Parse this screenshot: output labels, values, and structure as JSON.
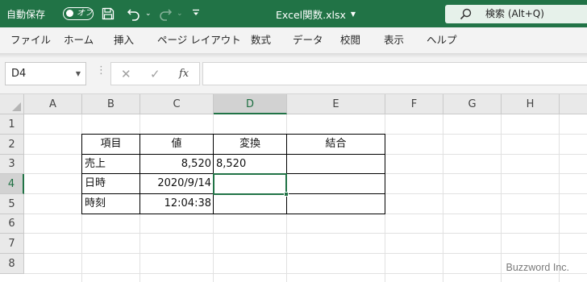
{
  "titlebar": {
    "autosave_label": "自動保存",
    "autosave_state": "オフ",
    "filename": "Excel関数.xlsx",
    "search_placeholder": "検索 (Alt+Q)"
  },
  "ribbon": {
    "tabs": [
      "ファイル",
      "ホーム",
      "挿入",
      "ページ レイアウト",
      "数式",
      "データ",
      "校閲",
      "表示",
      "ヘルプ"
    ]
  },
  "formula_bar": {
    "name_box": "D4",
    "fx_label": "fx",
    "formula": ""
  },
  "sheet": {
    "columns": [
      "A",
      "B",
      "C",
      "D",
      "E",
      "F",
      "G",
      "H"
    ],
    "rows": [
      "1",
      "2",
      "3",
      "4",
      "5",
      "6",
      "7",
      "8"
    ],
    "selected_column": "D",
    "selected_row": "4",
    "table": {
      "headers": [
        "項目",
        "値",
        "変換",
        "結合"
      ],
      "rows": [
        [
          "売上",
          "8,520",
          "8,520",
          ""
        ],
        [
          "日時",
          "2020/9/14",
          "",
          ""
        ],
        [
          "時刻",
          "12:04:38",
          "",
          ""
        ]
      ]
    }
  },
  "watermark": "Buzzword Inc.",
  "colors": {
    "excel_green": "#217346",
    "chrome_bg": "#f3f3f3",
    "header_bg": "#e9e9e9",
    "gridline": "#e1e1e1"
  },
  "icons": [
    "save-icon",
    "undo-icon",
    "redo-icon",
    "search-icon",
    "cancel-icon",
    "enter-icon",
    "function-icon",
    "select-all-icon"
  ]
}
